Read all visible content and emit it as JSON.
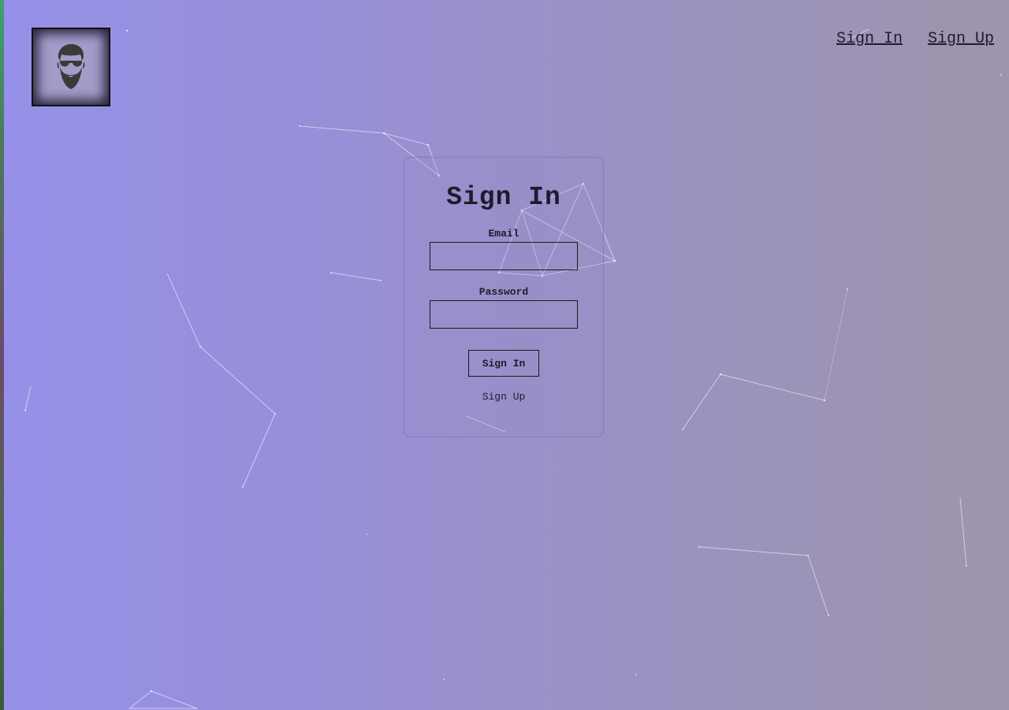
{
  "nav": {
    "sign_in": "Sign In",
    "sign_up": "Sign Up"
  },
  "logo": {
    "icon": "bearded-man-sunglasses-icon"
  },
  "form": {
    "title": "Sign In",
    "email_label": "Email",
    "email_value": "",
    "password_label": "Password",
    "password_value": "",
    "submit_label": "Sign In",
    "signup_link": "Sign Up"
  },
  "colors": {
    "gradient_left": "#9690e8",
    "gradient_right": "#9e94ac",
    "text": "#1e1b2e"
  }
}
